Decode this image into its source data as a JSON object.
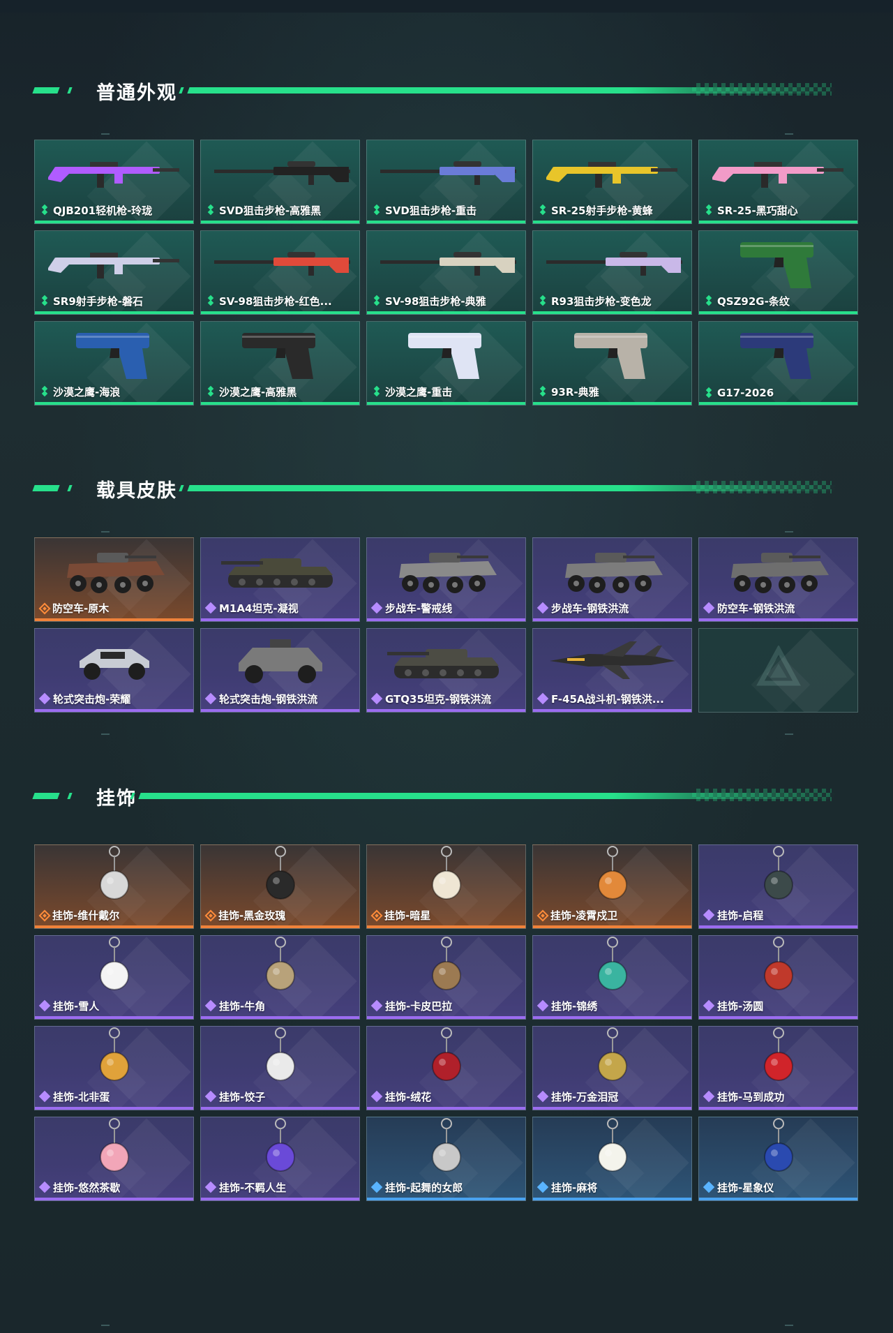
{
  "sections": [
    {
      "title": "普通外观",
      "items": [
        {
          "label": "QJB201轻机枪-玲珑",
          "rarity": "green",
          "icon": "rifle-icon",
          "color": "#b05cff"
        },
        {
          "label": "SVD狙击步枪-高雅黑",
          "rarity": "green",
          "icon": "sniper-rifle-icon",
          "color": "#222222"
        },
        {
          "label": "SVD狙击步枪-重击",
          "rarity": "green",
          "icon": "sniper-rifle-icon",
          "color": "#6a7cd8"
        },
        {
          "label": "SR-25射手步枪-黄蜂",
          "rarity": "green",
          "icon": "rifle-icon",
          "color": "#e8c52a"
        },
        {
          "label": "SR-25-黑巧甜心",
          "rarity": "green",
          "icon": "rifle-icon",
          "color": "#f29bc8"
        },
        {
          "label": "SR9射手步枪-磐石",
          "rarity": "green",
          "icon": "rifle-icon",
          "color": "#cfcfe8"
        },
        {
          "label": "SV-98狙击步枪-红色...",
          "rarity": "green",
          "icon": "sniper-rifle-icon",
          "color": "#e04a3a"
        },
        {
          "label": "SV-98狙击步枪-典雅",
          "rarity": "green",
          "icon": "sniper-rifle-icon",
          "color": "#d8d2c0"
        },
        {
          "label": "R93狙击步枪-变色龙",
          "rarity": "green",
          "icon": "sniper-rifle-icon",
          "color": "#c9b8e8"
        },
        {
          "label": "QSZ92G-条纹",
          "rarity": "green",
          "icon": "pistol-icon",
          "color": "#2f7a3a"
        },
        {
          "label": "沙漠之鹰-海浪",
          "rarity": "green",
          "icon": "pistol-icon",
          "color": "#2a5fb0"
        },
        {
          "label": "沙漠之鹰-高雅黑",
          "rarity": "green",
          "icon": "pistol-icon",
          "color": "#2a2a2a"
        },
        {
          "label": "沙漠之鹰-重击",
          "rarity": "green",
          "icon": "pistol-icon",
          "color": "#dfe4f4"
        },
        {
          "label": "93R-典雅",
          "rarity": "green",
          "icon": "pistol-icon",
          "color": "#b8b2a8"
        },
        {
          "label": "G17-2026",
          "rarity": "green",
          "icon": "pistol-icon",
          "color": "#2c3a7a"
        }
      ]
    },
    {
      "title": "载具皮肤",
      "items": [
        {
          "label": "防空车-原木",
          "rarity": "orange",
          "icon": "armored-vehicle-icon",
          "color": "#7a4a36"
        },
        {
          "label": "M1A4坦克-凝视",
          "rarity": "purple",
          "icon": "tank-icon",
          "color": "#4a4a3a"
        },
        {
          "label": "步战车-警戒线",
          "rarity": "purple",
          "icon": "armored-vehicle-icon",
          "color": "#8a8a8a"
        },
        {
          "label": "步战车-钢铁洪流",
          "rarity": "purple",
          "icon": "armored-vehicle-icon",
          "color": "#7c7c7c"
        },
        {
          "label": "防空车-钢铁洪流",
          "rarity": "purple",
          "icon": "armored-vehicle-icon",
          "color": "#6e6e6e"
        },
        {
          "label": "轮式突击炮-荣耀",
          "rarity": "purple",
          "icon": "buggy-icon",
          "color": "#c8ccd4"
        },
        {
          "label": "轮式突击炮-钢铁洪流",
          "rarity": "purple",
          "icon": "armored-car-icon",
          "color": "#7a7a7a"
        },
        {
          "label": "GTQ35坦克-钢铁洪流",
          "rarity": "purple",
          "icon": "tank-icon",
          "color": "#4c4c44"
        },
        {
          "label": "F-45A战斗机-钢铁洪...",
          "rarity": "purple",
          "icon": "jet-fighter-icon",
          "color": "#2e2e2e"
        },
        {
          "label": "",
          "rarity": "empty",
          "icon": "logo-watermark-icon",
          "color": "#2a4a4a"
        }
      ]
    },
    {
      "title": "挂饰",
      "items": [
        {
          "label": "挂饰-维什戴尔",
          "rarity": "orange",
          "icon": "charm-icon",
          "color": "#d8d8d8"
        },
        {
          "label": "挂饰-黑金玫瑰",
          "rarity": "orange",
          "icon": "charm-icon",
          "color": "#2a2a2a"
        },
        {
          "label": "挂饰-暗星",
          "rarity": "orange",
          "icon": "charm-icon",
          "color": "#efe6d4"
        },
        {
          "label": "挂饰-凌霄戍卫",
          "rarity": "orange",
          "icon": "charm-icon",
          "color": "#e2893a"
        },
        {
          "label": "挂饰-启程",
          "rarity": "purple",
          "icon": "charm-icon",
          "color": "#3c4a4a"
        },
        {
          "label": "挂饰-雪人",
          "rarity": "purple",
          "icon": "charm-icon",
          "color": "#f4f4f4"
        },
        {
          "label": "挂饰-牛角",
          "rarity": "purple",
          "icon": "charm-icon",
          "color": "#b8a27a"
        },
        {
          "label": "挂饰-卡皮巴拉",
          "rarity": "purple",
          "icon": "charm-icon",
          "color": "#9c7a52"
        },
        {
          "label": "挂饰-锦绣",
          "rarity": "purple",
          "icon": "charm-icon",
          "color": "#3ab4a0"
        },
        {
          "label": "挂饰-汤圆",
          "rarity": "purple",
          "icon": "charm-icon",
          "color": "#c0392b"
        },
        {
          "label": "挂饰-北非蛋",
          "rarity": "purple",
          "icon": "charm-icon",
          "color": "#e0a23a"
        },
        {
          "label": "挂饰-饺子",
          "rarity": "purple",
          "icon": "charm-icon",
          "color": "#eaeaea"
        },
        {
          "label": "挂饰-绒花",
          "rarity": "purple",
          "icon": "charm-icon",
          "color": "#b0202a"
        },
        {
          "label": "挂饰-万金泪冠",
          "rarity": "purple",
          "icon": "charm-icon",
          "color": "#c4a64a"
        },
        {
          "label": "挂饰-马到成功",
          "rarity": "purple",
          "icon": "charm-icon",
          "color": "#d0242a"
        },
        {
          "label": "挂饰-悠然茶歇",
          "rarity": "purple",
          "icon": "charm-icon",
          "color": "#f2a6b8"
        },
        {
          "label": "挂饰-不羁人生",
          "rarity": "purple",
          "icon": "charm-icon",
          "color": "#6a4ad8"
        },
        {
          "label": "挂饰-起舞的女郎",
          "rarity": "blue",
          "icon": "charm-icon",
          "color": "#c8c8c8"
        },
        {
          "label": "挂饰-麻将",
          "rarity": "blue",
          "icon": "charm-icon",
          "color": "#f4f4ec"
        },
        {
          "label": "挂饰-星象仪",
          "rarity": "blue",
          "icon": "charm-icon",
          "color": "#2a4ab0"
        }
      ]
    }
  ],
  "colors": {
    "accent": "#27e08b",
    "rarity_green": "#27e08b",
    "rarity_purple": "#9b6cf0",
    "rarity_orange": "#f0823a",
    "rarity_blue": "#4aa3f0"
  }
}
